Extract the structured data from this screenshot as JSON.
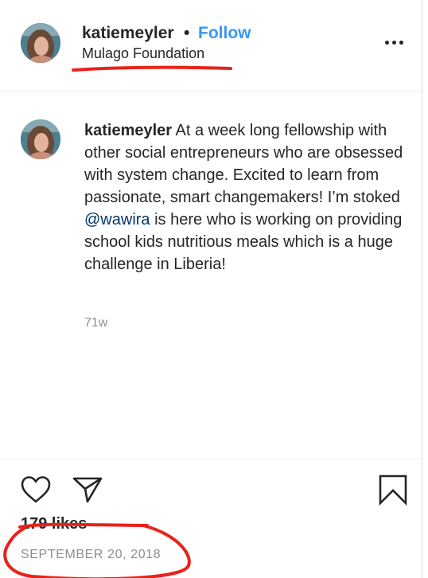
{
  "post": {
    "username": "katiemeyler",
    "separator": "•",
    "follow_label": "Follow",
    "location": "Mulago Foundation",
    "more_icon": "more-options-icon",
    "caption": {
      "username": "katiemeyler",
      "text_before_mention": " At a week long fellowship with other social entrepreneurs who are obsessed with system change. Excited to learn from passionate, smart changemakers! I’m stoked ",
      "mention": "@wawira",
      "text_after_mention": " is here who is working on providing school kids nutritious meals which is a huge challenge in Liberia!",
      "time_ago": "71w"
    },
    "actions": {
      "like_icon": "heart-icon",
      "share_icon": "paper-plane-icon",
      "save_icon": "bookmark-icon"
    },
    "likes_label": "179 likes",
    "date": "SEPTEMBER 20, 2018"
  },
  "colors": {
    "follow": "#3897f0",
    "mention": "#003569",
    "annotation": "#e8221b",
    "muted": "#8e8e8e"
  }
}
